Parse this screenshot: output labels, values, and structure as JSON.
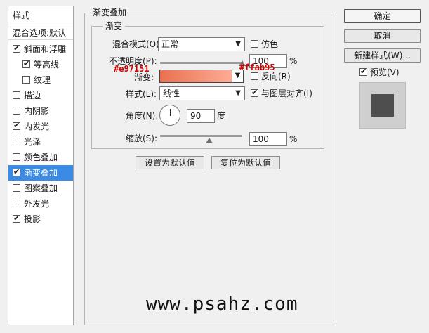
{
  "left_panel": {
    "title": "样式",
    "blend_header": "混合选项:默认",
    "items": [
      {
        "label": "斜面和浮雕",
        "checked": true,
        "indent": false,
        "selected": false
      },
      {
        "label": "等高线",
        "checked": true,
        "indent": true,
        "selected": false
      },
      {
        "label": "纹理",
        "checked": false,
        "indent": true,
        "selected": false
      },
      {
        "label": "描边",
        "checked": false,
        "indent": false,
        "selected": false
      },
      {
        "label": "内阴影",
        "checked": false,
        "indent": false,
        "selected": false
      },
      {
        "label": "内发光",
        "checked": true,
        "indent": false,
        "selected": false
      },
      {
        "label": "光泽",
        "checked": false,
        "indent": false,
        "selected": false
      },
      {
        "label": "颜色叠加",
        "checked": false,
        "indent": false,
        "selected": false
      },
      {
        "label": "渐变叠加",
        "checked": true,
        "indent": false,
        "selected": true
      },
      {
        "label": "图案叠加",
        "checked": false,
        "indent": false,
        "selected": false
      },
      {
        "label": "外发光",
        "checked": false,
        "indent": false,
        "selected": false
      },
      {
        "label": "投影",
        "checked": true,
        "indent": false,
        "selected": false
      }
    ]
  },
  "main": {
    "outer_legend": "渐变叠加",
    "inner_legend": "渐变",
    "blend_mode_label": "混合模式(O):",
    "blend_mode_value": "正常",
    "dither_label": "仿色",
    "dither_checked": false,
    "opacity_label": "不透明度(P):",
    "opacity_value": "100",
    "opacity_unit": "%",
    "opacity_fraction": 1.0,
    "gradient_label": "渐变:",
    "reverse_label": "反向(R)",
    "reverse_checked": false,
    "gradient_start_color": "#e97151",
    "gradient_end_color": "#ffab95",
    "style_label": "样式(L):",
    "style_value": "线性",
    "align_label": "与图层对齐(I)",
    "align_checked": true,
    "angle_label": "角度(N):",
    "angle_value": "90",
    "angle_unit": "度",
    "scale_label": "缩放(S):",
    "scale_value": "100",
    "scale_unit": "%",
    "scale_fraction": 0.6,
    "set_default_button": "设置为默认值",
    "reset_default_button": "复位为默认值"
  },
  "right": {
    "ok_button": "确定",
    "cancel_button": "取消",
    "new_style_button": "新建样式(W)...",
    "preview_label": "预览(V)",
    "preview_checked": true
  },
  "annotations": {
    "start_color": "#e97151",
    "end_color": "#ffab95"
  },
  "watermark": "www.psahz.com",
  "icons": {
    "check": "check-icon",
    "dropdown": "chevron-down-icon"
  }
}
